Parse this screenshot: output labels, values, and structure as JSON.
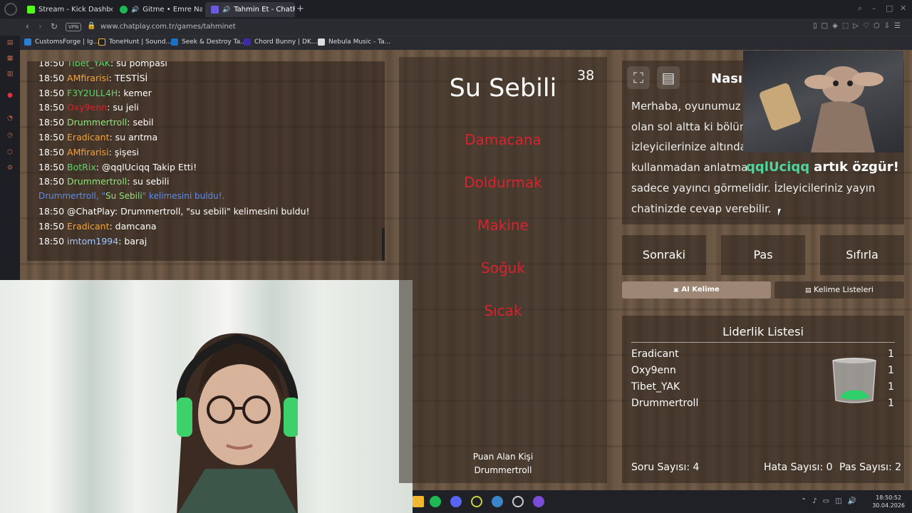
{
  "browser": {
    "tabs": [
      {
        "title": "Stream - Kick Dashboard",
        "color": "#53fc18",
        "glyph": "K"
      },
      {
        "title": "Gitme • Emre Nalbant...",
        "color": "#1db954",
        "glyph": ""
      },
      {
        "title": "Tahmin Et - ChatPlay",
        "color": "#6a5ae0",
        "glyph": "CP"
      }
    ],
    "vpn": "VPN",
    "url": "www.chatplay.com.tr/games/tahminet",
    "bookmarks": [
      {
        "title": "CustomsForge | Ig...",
        "color": "#2a7fd4"
      },
      {
        "title": "ToneHunt | Sound...",
        "color": "#222222"
      },
      {
        "title": "Seek & Destroy Ta...",
        "color": "#1b6fc4"
      },
      {
        "title": "Chord Bunny | DK...",
        "color": "#3a2ca8"
      },
      {
        "title": "Nebula Music - Ta...",
        "color": "#dddddd"
      }
    ]
  },
  "chat": {
    "messages": [
      {
        "time": "18:50",
        "user": "Tibet_YAK",
        "color": "#5bd46a",
        "text": ": su pompası"
      },
      {
        "time": "18:50",
        "user": "AMfirarisi",
        "color": "#f2a33a",
        "text": ": TESTİSİ"
      },
      {
        "time": "18:50",
        "user": "F3Y2ULL4H",
        "color": "#5bd46a",
        "text": ": kemer"
      },
      {
        "time": "18:50",
        "user": "Oxy9enn",
        "color": "#d8232f",
        "text": ": su jeli"
      },
      {
        "time": "18:50",
        "user": "Drummertroll",
        "color": "#8ee37e",
        "text": ": sebil"
      },
      {
        "time": "18:50",
        "user": "Eradicant",
        "color": "#f2a33a",
        "text": ": su arıtma"
      },
      {
        "time": "18:50",
        "user": "AMfirarisi",
        "color": "#f2a33a",
        "text": ": şişesi"
      },
      {
        "time": "18:50",
        "user": "BotRix",
        "color": "#5bd46a",
        "text": ": @qqlUciqq Takip Etti!"
      },
      {
        "time": "18:50",
        "user": "Drummertroll",
        "color": "#8ee37e",
        "text": ": su sebili"
      }
    ],
    "system": {
      "prefix": "Drummertroll, \"",
      "word": "Su Sebili",
      "suffix": "\" kelimesini buldu!."
    },
    "messages2": [
      {
        "time": "18:50",
        "user": "@ChatPlay",
        "color": "#ffffff",
        "text": ": Drummertroll, \"su sebili\" kelimesini buldu!"
      },
      {
        "time": "18:50",
        "user": "Eradicant",
        "color": "#f2a33a",
        "text": ": damcana"
      },
      {
        "time": "18:50",
        "user": "imtom1994",
        "color": "#9fc7ff",
        "text": ": baraj"
      }
    ]
  },
  "game": {
    "count": "38",
    "word": "Su Sebili",
    "taboo": [
      "Damacana",
      "Doldurmak",
      "Makine",
      "Soğuk",
      "Sıcak"
    ],
    "scorer_label": "Puan Alan Kişi",
    "scorer_name": "Drummertroll"
  },
  "help": {
    "title": "Nası",
    "lines": [
      "Merhaba, oyunumuz",
      "olan sol altta ki bölüm",
      "izleyicilerinize altında",
      "kullanmadan anlatma",
      "sadece yayıncı görmelidir. İzleyicileriniz yayın",
      "chatinizde cevap verebilir."
    ]
  },
  "overlay": {
    "user": "qqlUciqq",
    "message": "artık özgür!"
  },
  "actions": {
    "next": "Sonraki",
    "pass": "Pas",
    "reset": "Sıfırla"
  },
  "sub_actions": {
    "ai": "AI Kelime",
    "lists": "Kelime Listeleri"
  },
  "leaderboard": {
    "title": "Liderlik Listesi",
    "rows": [
      {
        "name": "Eradicant",
        "score": "1"
      },
      {
        "name": "Oxy9enn",
        "score": "1"
      },
      {
        "name": "Tibet_YAK",
        "score": "1"
      },
      {
        "name": "Drummertroll",
        "score": "1"
      }
    ]
  },
  "stats": {
    "questions": "Soru Sayısı: 4",
    "errors": "Hata Sayısı: 0",
    "passes": "Pas Sayısı: 2"
  },
  "taskbar": {
    "time": "18:50:52",
    "date": "30.04.2026"
  },
  "colors": {
    "accent_green": "#4ed6a0",
    "taboo_red": "#d8232f",
    "system_blue": "#5b8cf0"
  }
}
